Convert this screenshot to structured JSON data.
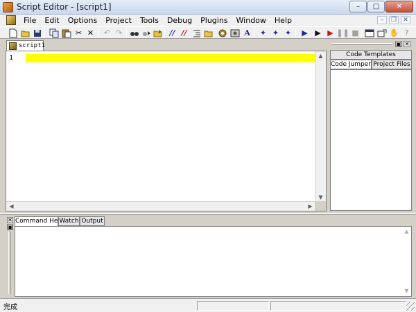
{
  "window": {
    "title": "Script Editor - [script1]",
    "controls": {
      "minimize": "–",
      "maximize": "□",
      "close": "✕"
    }
  },
  "menubar": {
    "items": [
      "File",
      "Edit",
      "Options",
      "Project",
      "Tools",
      "Debug",
      "Plugins",
      "Window",
      "Help"
    ],
    "mdi_controls": {
      "minimize": "–",
      "restore": "❐",
      "close": "✕"
    }
  },
  "toolbar": {
    "icons": [
      "new-file-icon",
      "open-folder-icon",
      "save-icon",
      "copy-icon",
      "paste-icon",
      "cut-icon",
      "delete-icon",
      "undo-icon",
      "redo-icon",
      "find-icon",
      "find-next-icon",
      "open-project-icon",
      "comment-icon",
      "uncomment-icon",
      "indent-icon",
      "folder-icon",
      "plugin-icon",
      "settings-icon",
      "font-icon",
      "bookmark-icon",
      "bookmark-next-icon",
      "bookmark-prev-icon",
      "run-icon",
      "step-icon",
      "run-red-icon",
      "pause-icon",
      "stop-icon",
      "window-icon",
      "window-export-icon",
      "hand-icon",
      "help-icon"
    ]
  },
  "editor": {
    "tab_label": "script1",
    "line_numbers": [
      "1"
    ],
    "highlight_color": "#ffff00"
  },
  "right_panel": {
    "tabs": {
      "code_templates": "Code Templates",
      "code_jumper": "Code Jumper",
      "project_files": "Project Files"
    },
    "controls": {
      "pin": "▣",
      "close": "✕"
    }
  },
  "bottom_panel": {
    "tabs": [
      "Command Help",
      "Watch",
      "Output"
    ],
    "controls": {
      "close": "✕",
      "pin": "▣"
    }
  },
  "statusbar": {
    "text": "完成"
  },
  "scroll_arrows": {
    "up": "▲",
    "down": "▼",
    "left": "◀",
    "right": "▶"
  }
}
